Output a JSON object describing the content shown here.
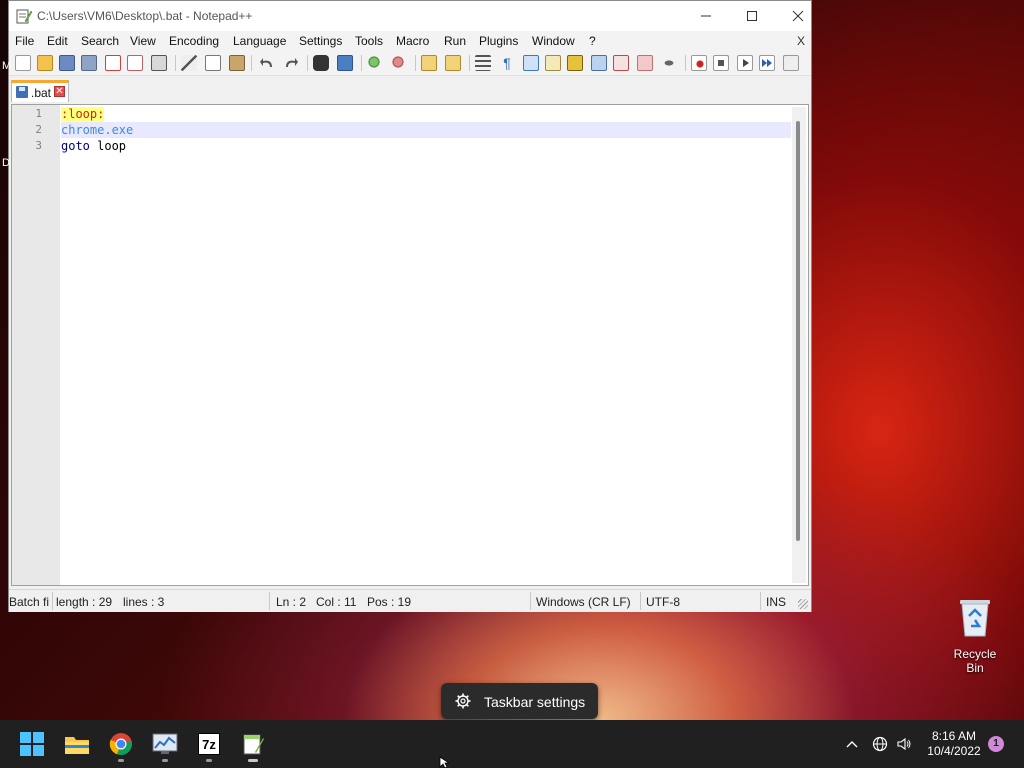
{
  "window": {
    "title": "C:\\Users\\VM6\\Desktop\\.bat - Notepad++",
    "min_label": "—",
    "max_label": "☐",
    "close_label": "✕"
  },
  "menu": {
    "items": [
      "File",
      "Edit",
      "Search",
      "View",
      "Encoding",
      "Language",
      "Settings",
      "Tools",
      "Macro",
      "Run",
      "Plugins",
      "Window",
      "?"
    ],
    "close_doc": "X"
  },
  "toolbar": {
    "icons": [
      "new-file",
      "open-file",
      "save",
      "save-all",
      "close",
      "close-all",
      "print",
      "cut",
      "copy",
      "paste",
      "undo",
      "redo",
      "find",
      "replace",
      "zoom-in",
      "zoom-out",
      "sync-vertical",
      "sync-horizontal",
      "word-wrap",
      "show-all-chars",
      "indent-guide",
      "doc-map",
      "function-list",
      "folder-workspace",
      "monitoring",
      "user-defined-lang",
      "view-eye",
      "record-macro",
      "stop-macro",
      "play-macro",
      "run-macro-multiple",
      "save-macro"
    ]
  },
  "tab": {
    "label": ".bat",
    "close": "✕"
  },
  "editor": {
    "lines": [
      {
        "num": "1",
        "tokens": [
          {
            "text": ":loop:",
            "cls": "label-tok"
          }
        ]
      },
      {
        "num": "2",
        "tokens": [
          {
            "text": "chrome.exe",
            "cls": "cmd-tok"
          }
        ]
      },
      {
        "num": "3",
        "tokens": [
          {
            "text": "goto",
            "cls": "kw-tok"
          },
          {
            "text": " loop",
            "cls": "plain-tok"
          }
        ]
      }
    ]
  },
  "status": {
    "lang": "Batch fi",
    "length": "length : 29",
    "lines": "lines : 3",
    "ln": "Ln : 2",
    "col": "Col : 11",
    "pos": "Pos : 19",
    "eol": "Windows (CR LF)",
    "encoding": "UTF-8",
    "mode": "INS"
  },
  "desktop": {
    "recycle_label": "Recycle Bin",
    "tooltip": "Taskbar settings",
    "edge_chars": [
      "M",
      "D"
    ]
  },
  "taskbar": {
    "apps": [
      "start",
      "file-explorer",
      "chrome",
      "resource-monitor",
      "7zip",
      "notepad-plus-plus"
    ],
    "sevenzip_label": "7z",
    "time": "8:16 AM",
    "date": "10/4/2022",
    "notification_count": "1"
  },
  "colors": {
    "accent": "#0078d4",
    "tab_accent": "#f7a830"
  }
}
